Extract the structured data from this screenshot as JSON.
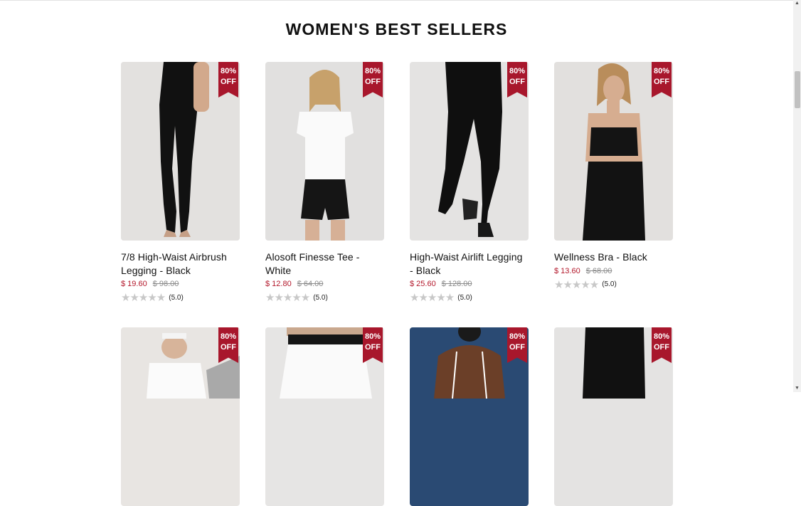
{
  "section_title": "WOMEN'S BEST SELLERS",
  "badge": {
    "line1": "80%",
    "line2": "OFF"
  },
  "products": [
    {
      "name": "7/8 High-Waist Airbrush Legging - Black",
      "price": "$ 19.60",
      "old_price": "$ 98.00",
      "rating": "(5.0)",
      "image": "legging-photo"
    },
    {
      "name": "Alosoft Finesse Tee - White",
      "price": "$ 12.80",
      "old_price": "$ 64.00",
      "rating": "(5.0)",
      "image": "tee-photo"
    },
    {
      "name": "High-Waist Airlift Legging - Black",
      "price": "$ 25.60",
      "old_price": "$ 128.00",
      "rating": "(5.0)",
      "image": "legging-photo"
    },
    {
      "name": "Wellness Bra - Black",
      "price": "$ 13.60",
      "old_price": "$ 68.00",
      "rating": "(5.0)",
      "image": "bra-photo"
    },
    {
      "name": "",
      "price": "",
      "old_price": "",
      "rating": "",
      "image": "tee-photo"
    },
    {
      "name": "",
      "price": "",
      "old_price": "",
      "rating": "",
      "image": "skirt-photo"
    },
    {
      "name": "",
      "price": "",
      "old_price": "",
      "rating": "",
      "image": "back-photo"
    },
    {
      "name": "",
      "price": "",
      "old_price": "",
      "rating": "",
      "image": "legging-photo"
    }
  ],
  "colors": {
    "accent": "#a8172c",
    "price": "#b3182b"
  },
  "icons": {
    "star": "star-icon",
    "scroll_up": "arrow-up-icon",
    "scroll_down": "arrow-down-icon"
  }
}
